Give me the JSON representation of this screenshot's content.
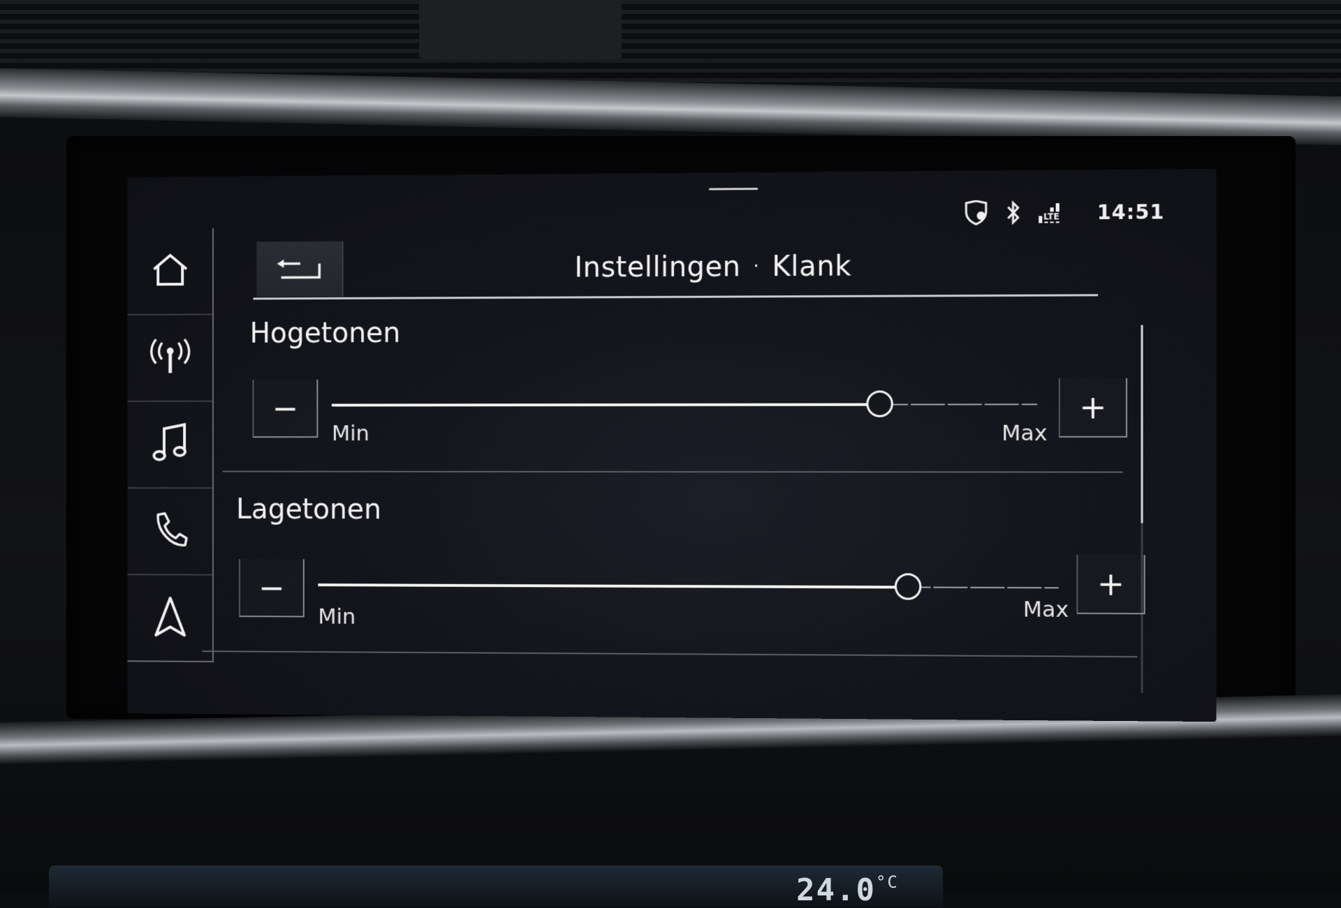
{
  "status_bar": {
    "icons": [
      "shield-location-icon",
      "bluetooth-icon",
      "lte-signal-icon"
    ],
    "lte_label": "LTE",
    "time": "14:51"
  },
  "nav": {
    "items": [
      {
        "icon": "home-icon"
      },
      {
        "icon": "radio-icon"
      },
      {
        "icon": "music-icon"
      },
      {
        "icon": "phone-icon"
      },
      {
        "icon": "navigation-icon"
      }
    ]
  },
  "header": {
    "title_part1": "Instellingen",
    "separator": "·",
    "title_part2": "Klank"
  },
  "settings": [
    {
      "label": "Hogetonen",
      "minus_label": "−",
      "plus_label": "+",
      "min_label": "Min",
      "max_label": "Max",
      "level_fraction": 0.78
    },
    {
      "label": "Lagetonen",
      "minus_label": "−",
      "plus_label": "+",
      "min_label": "Min",
      "max_label": "Max",
      "level_fraction": 0.8
    }
  ],
  "cluster": {
    "temperature_text": "24.0",
    "unit": "°C"
  },
  "colors": {
    "screen_bg": "#14151c",
    "text": "#f2f2f2",
    "line": "#c9cbcf"
  }
}
